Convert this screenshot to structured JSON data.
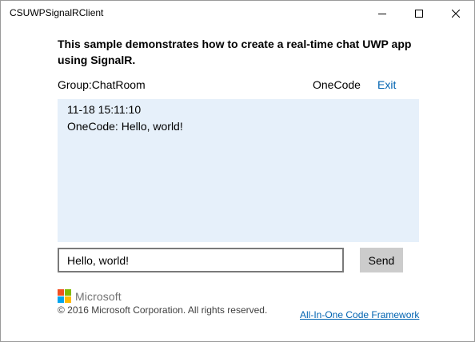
{
  "window": {
    "title": "CSUWPSignalRClient"
  },
  "description": "This sample demonstrates how to create a real-time chat UWP app using SignalR.",
  "header": {
    "group": "Group:ChatRoom",
    "username": "OneCode",
    "exit_label": "Exit"
  },
  "messages": [
    {
      "time": "11-18 15:11:10",
      "text": "OneCode: Hello, world!"
    }
  ],
  "composer": {
    "input_value": "Hello, world!",
    "send_label": "Send"
  },
  "footer": {
    "brand": "Microsoft",
    "copyright": "© 2016 Microsoft Corporation. All rights reserved.",
    "link_label": "All-In-One Code Framework"
  },
  "colors": {
    "link": "#0063b1",
    "message_bg": "#e6f0fa",
    "send_bg": "#cccccc"
  },
  "icons": [
    "minimize-icon",
    "maximize-icon",
    "close-icon",
    "microsoft-logo-icon"
  ]
}
